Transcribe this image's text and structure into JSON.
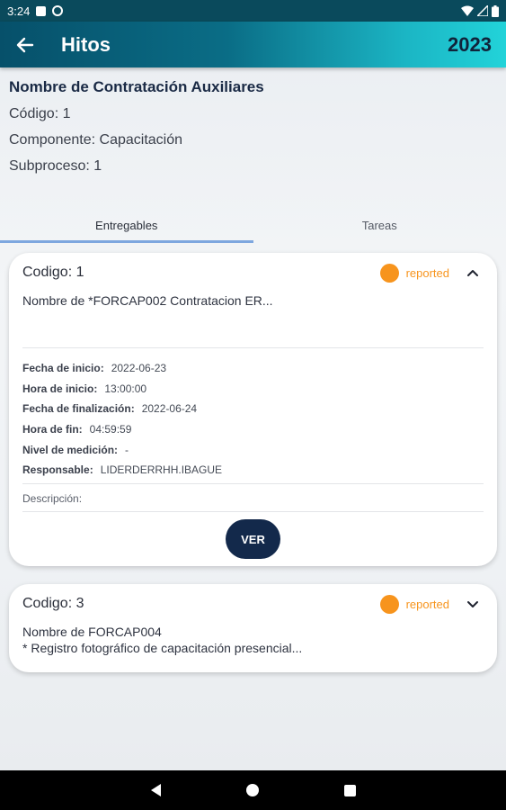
{
  "status_bar": {
    "time": "3:24"
  },
  "app_bar": {
    "title": "Hitos",
    "year": "2023"
  },
  "header": {
    "contract_name": "Nombre de Contratación Auxiliares",
    "codigo": "Código: 1",
    "componente": "Componente: Capacitación",
    "subproceso": "Subproceso: 1"
  },
  "tabs": [
    {
      "label": "Entregables",
      "active": true
    },
    {
      "label": "Tareas",
      "active": false
    }
  ],
  "cards": [
    {
      "code": "Codigo: 1",
      "status": "reported",
      "status_color": "#f7941d",
      "expanded": true,
      "name_lines": [
        "Nombre de *FORCAP002 Contratacion ER..."
      ],
      "details": [
        {
          "label": "Fecha de inicio:",
          "value": "2022-06-23"
        },
        {
          "label": "Hora de inicio:",
          "value": "13:00:00"
        },
        {
          "label": "Fecha de finalización:",
          "value": "2022-06-24"
        },
        {
          "label": "Hora de fin:",
          "value": "04:59:59"
        },
        {
          "label": "Nivel de medición:",
          "value": "-"
        },
        {
          "label": "Responsable:",
          "value": "LIDERDERRHH.IBAGUE"
        }
      ],
      "description_label": "Descripción:",
      "button_label": "VER"
    },
    {
      "code": "Codigo: 3",
      "status": "reported",
      "status_color": "#f7941d",
      "expanded": false,
      "name_lines": [
        "Nombre de FORCAP004",
        "* Registro fotográfico de capacitación presencial..."
      ]
    }
  ],
  "icons": {
    "back": "arrow-left-icon",
    "collapse": "chevron-up-icon",
    "expand": "chevron-down-icon"
  },
  "colors": {
    "accent_dark": "#13294b",
    "status_reported": "#f7941d",
    "tab_indicator": "#7ea7df"
  }
}
